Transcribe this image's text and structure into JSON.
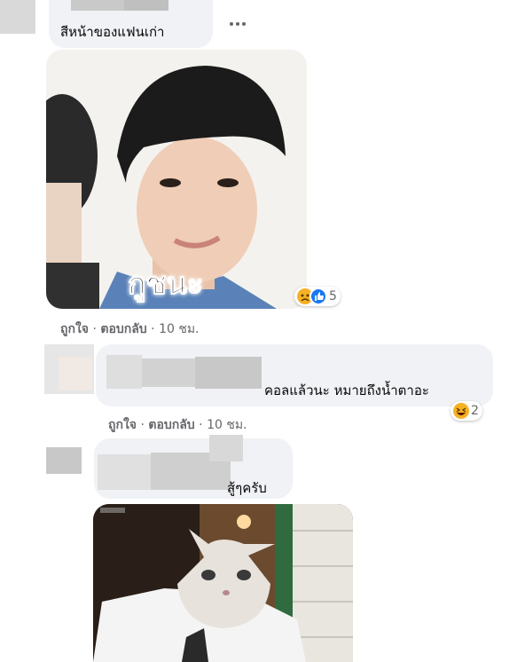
{
  "comment1": {
    "text": "สีหน้าของแฟนเก่า",
    "more_icon": "ellipsis-icon",
    "sticker_caption": "กูชนะ",
    "reaction_count": "5",
    "reaction_icons": [
      "sad-icon",
      "like-icon"
    ],
    "like_label": "ถูกใจ",
    "reply_label": "ตอบกลับ",
    "time": "10 ชม.",
    "sep": "·"
  },
  "comment2": {
    "text": "คอลแล้วนะ หมายถึงน้ำตาอะ",
    "reaction_count": "2",
    "reaction_icons": [
      "haha-icon"
    ],
    "like_label": "ถูกใจ",
    "reply_label": "ตอบกลับ",
    "time": "10 ชม.",
    "sep": "·"
  },
  "comment3": {
    "text": "สู้ๆครับ"
  },
  "colors": {
    "bubble": "#f0f2f5",
    "meta": "#65676b",
    "like_blue": "#1877f2",
    "emoji_yellow": "#f7b125"
  }
}
